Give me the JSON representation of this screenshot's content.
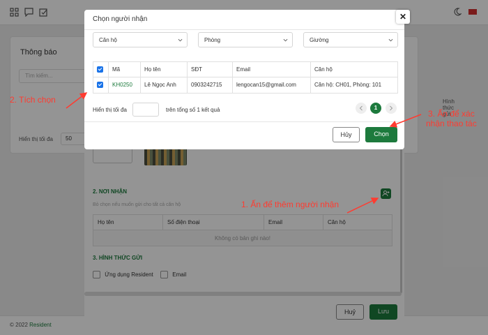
{
  "background": {
    "notice_title": "Thông báo",
    "search_placeholder": "Tìm kiếm...",
    "show_label": "Hiển thị tối đa",
    "show_value": "50",
    "send_method_right": "Hình thức gửi",
    "footer_text": "© 2022",
    "footer_brand": "Resident"
  },
  "form": {
    "section2_title": "2. NƠI NHẬN",
    "section2_hint": "Bỏ chọn nếu muốn gửi cho tất cả căn hộ",
    "table_columns": [
      "Họ tên",
      "Số điện thoại",
      "Email",
      "Căn hộ"
    ],
    "table_empty": "Không có bản ghi nào!",
    "section3_title": "3. HÌNH THỨC GỬI",
    "option_app": "Ứng dụng Resident",
    "option_email": "Email",
    "cancel_label": "Huỷ",
    "save_label": "Lưu"
  },
  "dialog": {
    "title": "Chọn người nhận",
    "close_symbol": "✕",
    "filters": [
      "Căn hộ",
      "Phòng",
      "Giường"
    ],
    "columns": [
      "Mã",
      "Họ tên",
      "SĐT",
      "Email",
      "Căn hộ"
    ],
    "rows": [
      {
        "code": "KH0250",
        "name": "Lê Ngọc Anh",
        "phone": "0903242715",
        "email": "lengocan15@gmail.com",
        "apartment": "Căn hộ: CH01, Phòng: 101"
      }
    ],
    "show_label": "Hiển thị tối đa",
    "total_label": "trên tổng số 1 kết quả",
    "current_page": "1",
    "cancel_label": "Hủy",
    "select_label": "Chọn"
  },
  "annotations": {
    "step1": "1. Ấn để thêm người nhận",
    "step2": "2. Tích chọn",
    "step3_line1": "3. Ấn để xác",
    "step3_line2": "nhận thao tác"
  },
  "colors": {
    "primary_green": "#1d7a3d",
    "annotation_red": "#ff3b30",
    "checkbox_blue": "#1a73e8"
  },
  "icons": [
    "grid-icon",
    "chat-icon",
    "edit-icon",
    "moon-icon",
    "flag-icon",
    "add-user-icon",
    "close-icon",
    "chevron-down-icon",
    "chevron-left-icon",
    "chevron-right-icon"
  ]
}
